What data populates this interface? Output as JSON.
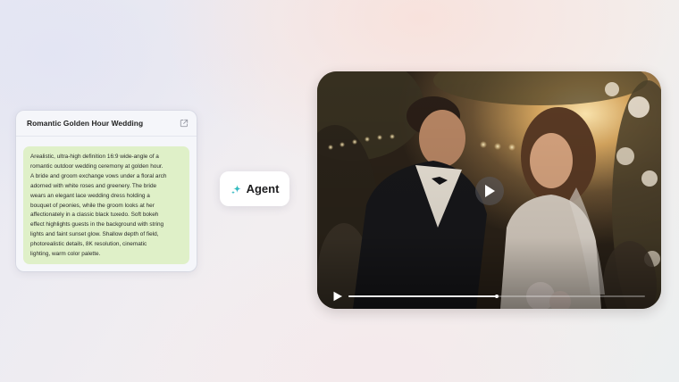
{
  "prompt_card": {
    "title": "Romantic Golden Hour Wedding",
    "external_link_icon": "external-link-icon",
    "lines": [
      "Arealistic, ultra-high definition 16:9 wide-angle of a",
      "romantic outdoor wedding ceremony at golden hour.",
      "A bride and groom exchange vows under a floral arch",
      "adorned with white roses and greenery. The bride",
      "wears an elegant lace wedding dress holding a",
      "bouquet of peonies, while the groom looks at her",
      "affectionately in a classic black tuxedo. Soft bokeh",
      "effect highlights guests in the background with string",
      "lights and faint sunset glow. Shallow depth of field,",
      "photorealistic details, 8K resolution, cinematic",
      "lighting, warm color palette."
    ],
    "body_color": "#dff0c8"
  },
  "agent_button": {
    "label": "Agent",
    "icon": "sparkle-icon",
    "icon_colors": [
      "#2fd39a",
      "#3aa0e8"
    ]
  },
  "video_player": {
    "center_icon": "play-icon",
    "control_icon": "play-icon",
    "progress": 0.5
  }
}
